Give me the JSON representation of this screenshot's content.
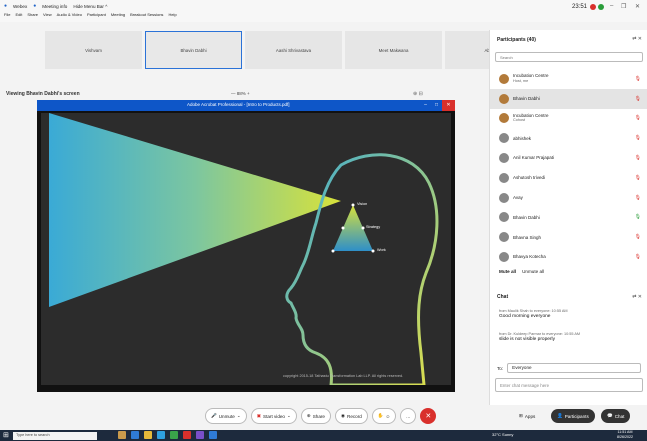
{
  "topbar": {
    "app_title": "Webex",
    "meeting_info": "Meeting info",
    "hide_menu": "Hide Menu Bar ^",
    "clock": "23:51",
    "menu": [
      "File",
      "Edit",
      "Share",
      "View",
      "Audio & Video",
      "Participant",
      "Meeting",
      "Breakout Sessions",
      "Help"
    ]
  },
  "tiles": [
    "Vishvam",
    "Bhavin Dabhi",
    "Aashi Shrivastava",
    "Meet Makwana",
    "Abhishek"
  ],
  "share": {
    "viewing": "Viewing Bhavin Dabhi's screen",
    "zoom": "— 88% +",
    "window_title": "Adobe Acrobat Professional - [Intro to Products.pdf]",
    "copyright": "copyright 2015-18 Tathastu Transformation Lab LLP. All rights reserved.",
    "labels": {
      "vision": "Vision",
      "strategy": "Strategy",
      "work": "Work"
    }
  },
  "controls": {
    "unmute": "Unmute",
    "video": "Start video",
    "share": "Share",
    "record": "Record",
    "apps": "Apps",
    "participants": "Participants",
    "chat": "Chat"
  },
  "participants": {
    "title": "Participants (40)",
    "search_placeholder": "Search",
    "items": [
      {
        "name": "Incubation Centre",
        "sub": "Host, me",
        "mic": "red",
        "photo": true
      },
      {
        "name": "Bhavin Dabhi",
        "sub": "",
        "mic": "red",
        "photo": true,
        "selected": true
      },
      {
        "name": "Incubation Centre",
        "sub": "Cohost",
        "mic": "red",
        "photo": true
      },
      {
        "name": "abhishek",
        "sub": "",
        "mic": "red",
        "photo": false
      },
      {
        "name": "Anil Kumar Prajapati",
        "sub": "",
        "mic": "red",
        "photo": false
      },
      {
        "name": "Ashutosh trivedi",
        "sub": "",
        "mic": "red",
        "photo": false
      },
      {
        "name": "Avay",
        "sub": "",
        "mic": "red",
        "photo": false
      },
      {
        "name": "Bhavin Dabhi",
        "sub": "",
        "mic": "on",
        "photo": false
      },
      {
        "name": "Bhavna Singh",
        "sub": "",
        "mic": "red",
        "photo": false
      },
      {
        "name": "Bhavya Kotecha",
        "sub": "",
        "mic": "red",
        "photo": false
      }
    ],
    "mute_all": "Mute all",
    "unmute_all": "Unmute all"
  },
  "chat": {
    "title": "Chat",
    "messages": [
      {
        "meta": "from Maulik Shah to everyone:   10:55 AM",
        "text": "Good morning everyone"
      },
      {
        "meta": "from Dr. Kuldeep Parmar to everyone:   10:55 AM",
        "text": "slide is not visible properly"
      }
    ],
    "to_label": "To:",
    "to_value": "Everyone",
    "input_placeholder": "Enter chat message here"
  },
  "taskbar": {
    "search_placeholder": "Type here to search",
    "tray": "32°C  Sunny",
    "time": "11:51 AM",
    "date": "8/26/2022"
  },
  "colors": {
    "accent": "#2b72d7",
    "red": "#d9302c",
    "slide_bg": "#2c2c2c"
  }
}
